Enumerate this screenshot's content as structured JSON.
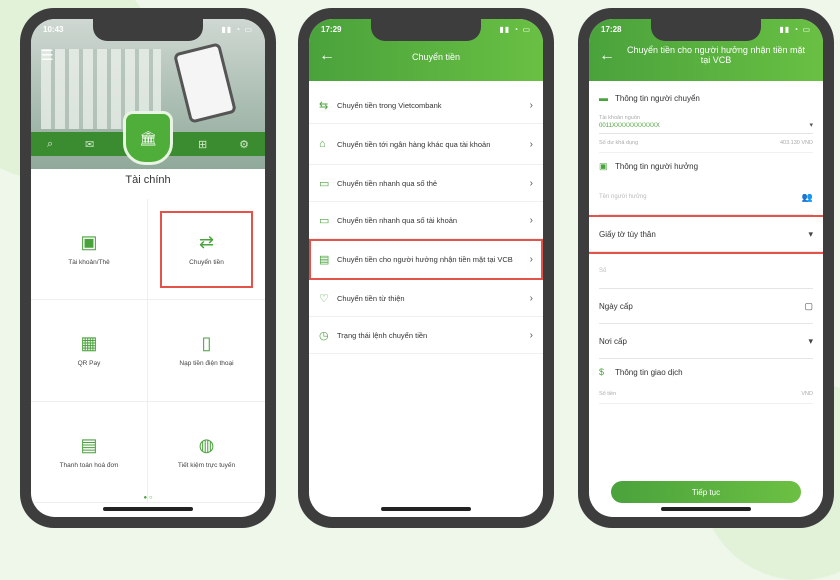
{
  "phone1": {
    "status_time": "10:43",
    "section_title": "Tài chính",
    "tiles": [
      {
        "label": "Tài khoản/Thẻ",
        "icon": "wallet-icon"
      },
      {
        "label": "Chuyển tiền",
        "icon": "transfer-icon",
        "highlighted": true
      },
      {
        "label": "QR Pay",
        "icon": "qr-icon"
      },
      {
        "label": "Nạp tiền điện thoại",
        "icon": "phone-topup-icon"
      },
      {
        "label": "Thanh toán hoá đơn",
        "icon": "bill-icon"
      },
      {
        "label": "Tiết kiệm trực tuyến",
        "icon": "piggy-bank-icon"
      }
    ]
  },
  "phone2": {
    "status_time": "17:29",
    "title": "Chuyển tiền",
    "items": [
      {
        "label": "Chuyển tiền trong Vietcombank"
      },
      {
        "label": "Chuyển tiền tới ngân hàng khác qua tài khoản"
      },
      {
        "label": "Chuyển tiền nhanh qua số thẻ"
      },
      {
        "label": "Chuyển tiền nhanh qua số tài khoản"
      },
      {
        "label": "Chuyển tiền cho người hưởng nhận tiền mặt tại VCB",
        "highlighted": true
      },
      {
        "label": "Chuyển tiền từ thiện"
      },
      {
        "label": "Trạng thái lệnh chuyển tiền"
      }
    ]
  },
  "phone3": {
    "status_time": "17:28",
    "title": "Chuyển tiền cho người hưởng nhận tiền mặt tại VCB",
    "sender_section": "Thông tin người chuyển",
    "source_account_label": "Tài khoản nguồn",
    "source_account_value": "0011XXXXXXXXXXXX",
    "balance_label": "Số dư khả dụng",
    "balance_value": "403.130 VND",
    "receiver_section": "Thông tin người hưởng",
    "receiver_name_placeholder": "Tên người hưởng",
    "id_doc_label": "Giấy tờ tùy thân",
    "id_number_placeholder": "Số",
    "issue_date_label": "Ngày cấp",
    "issue_place_label": "Nơi cấp",
    "transaction_section": "Thông tin giao dịch",
    "amount_label": "Số tiền",
    "amount_unit": "VND",
    "continue_label": "Tiếp tục"
  }
}
